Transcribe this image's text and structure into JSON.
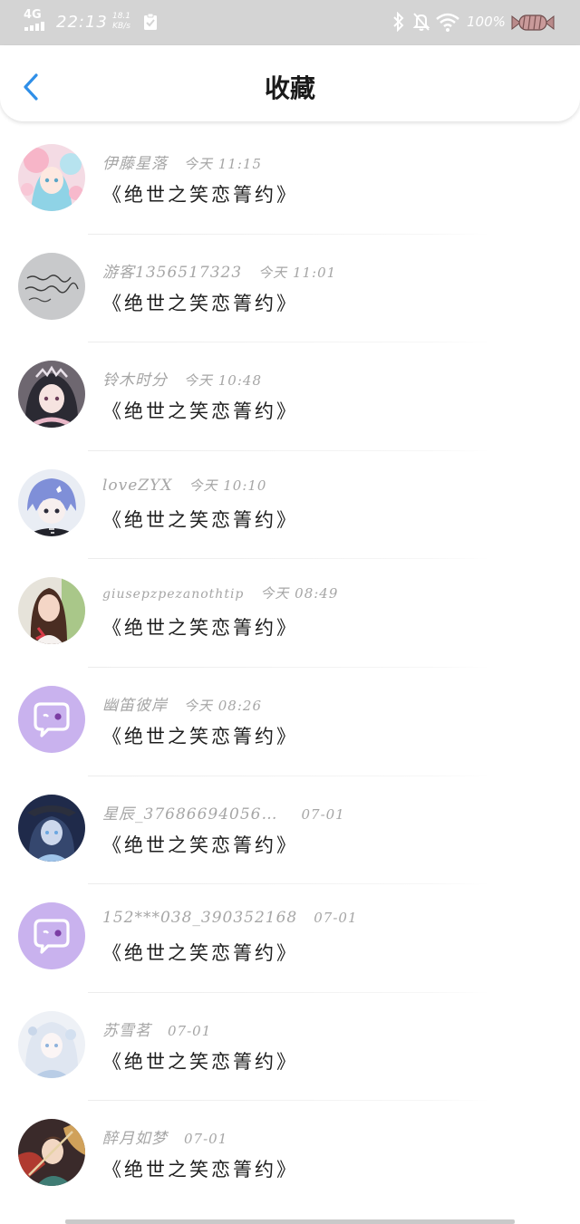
{
  "status_bar": {
    "network": "4G",
    "time": "22:13",
    "speed_value": "18.1",
    "speed_unit": "KB/s",
    "battery_text": "100%",
    "icons": [
      "signal-icon",
      "clipboard-check-icon",
      "bluetooth-icon",
      "mute-icon",
      "wifi-icon",
      "candy-battery-icon"
    ]
  },
  "header": {
    "title": "收藏",
    "back_icon": "chevron-left-icon"
  },
  "colors": {
    "accent": "#2f8fe8",
    "status_bar_bg": "#d4d4d4",
    "meta_text": "#a6a6a6",
    "title_text": "#1e1e1e",
    "default_avatar": "#c9b2ee"
  },
  "items": [
    {
      "name": "伊藤星落",
      "time": "今天 11:15",
      "title": "《绝世之笑恋箐约》",
      "avatar": "anime-pink-avatar"
    },
    {
      "name": "游客1356517323",
      "time": "今天 11:01",
      "title": "《绝世之笑恋箐约》",
      "avatar": "handwriting-avatar"
    },
    {
      "name": "铃木时分",
      "time": "今天 10:48",
      "title": "《绝世之笑恋箐约》",
      "avatar": "anime-tiara-avatar"
    },
    {
      "name": "loveZYX",
      "time": "今天 10:10",
      "title": "《绝世之笑恋箐约》",
      "avatar": "anime-blue-hair-avatar"
    },
    {
      "name": "giusepzpezanothtip",
      "time": "今天 08:49",
      "title": "《绝世之笑恋箐约》",
      "avatar": "photo-girl-avatar"
    },
    {
      "name": "幽笛彼岸",
      "time": "今天 08:26",
      "title": "《绝世之笑恋箐约》",
      "avatar": "default-chat-avatar"
    },
    {
      "name": "星辰_37686694056…",
      "time": "07-01",
      "title": "《绝世之笑恋箐约》",
      "avatar": "anime-dark-avatar"
    },
    {
      "name": "152***038_390352168",
      "time": "07-01",
      "title": "《绝世之笑恋箐约》",
      "avatar": "default-chat-avatar"
    },
    {
      "name": "苏雪茗",
      "time": "07-01",
      "title": "《绝世之笑恋箐约》",
      "avatar": "anime-white-avatar"
    },
    {
      "name": "醉月如梦",
      "time": "07-01",
      "title": "《绝世之笑恋箐约》",
      "avatar": "anime-warrior-avatar"
    }
  ]
}
